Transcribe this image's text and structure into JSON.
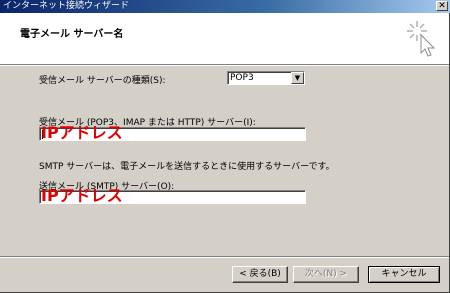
{
  "window": {
    "title": "インターネット接続ウィザード",
    "close_glyph": "✕"
  },
  "header": {
    "heading": "電子メール サーバー名"
  },
  "incoming_server_type": {
    "label": "受信メール サーバーの種類(S):",
    "selected": "POP3"
  },
  "incoming_server": {
    "label": "受信メール (POP3、IMAP または HTTP) サーバー(I):",
    "annotation": "IPアドレス"
  },
  "smtp_note": "SMTP サーバーは、電子メールを送信するときに使用するサーバーです。",
  "outgoing_server": {
    "label": "送信メール (SMTP) サーバー(O):",
    "annotation": "IPアドレス"
  },
  "buttons": {
    "back": "< 戻る(B)",
    "next": "次へ(N) >",
    "cancel": "キャンセル"
  },
  "icons": {
    "wizard": "wizard-sparkle-cursor-icon",
    "dropdown": "chevron-down-icon"
  }
}
